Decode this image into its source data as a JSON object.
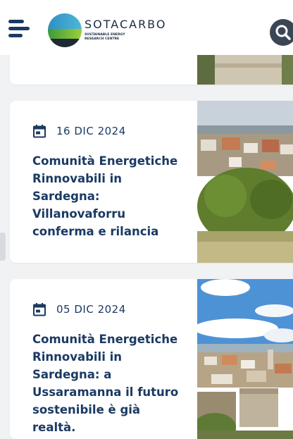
{
  "header": {
    "logo_name": "SOTACARBO",
    "logo_sub": "SUSTAINABLE ENERGY RESEARCH CENTRE"
  },
  "icons": {
    "menu": "hamburger-menu-icon",
    "search": "search-icon",
    "date": "calendar-icon"
  },
  "colors": {
    "title": "#1b3a63",
    "search_bg": "#3a4656",
    "background": "#f1f2f4"
  },
  "articles": [
    {
      "date": "16 DIC 2024",
      "title": "Comunità Energetiche Rinnovabili in Sardegna: Villanovaforru conferma e rilancia"
    },
    {
      "date": "05 DIC 2024",
      "title": "Comunità Energetiche Rinnovabili in Sardegna: a Ussaramanna il futuro sostenibile è già realtà."
    }
  ]
}
